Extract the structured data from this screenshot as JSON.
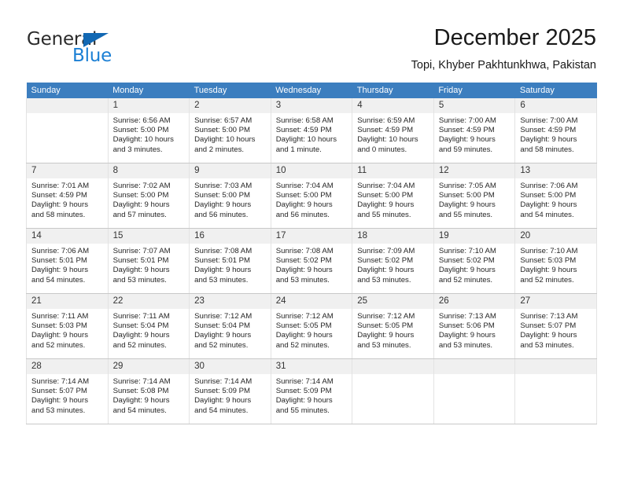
{
  "brand": {
    "name_part1": "General",
    "name_part2": "Blue",
    "accent_color": "#1b7fd4",
    "triangle_color": "#1268b3"
  },
  "header": {
    "title": "December 2025",
    "subtitle": "Topi, Khyber Pakhtunkhwa, Pakistan"
  },
  "calendar": {
    "header_bg": "#3c7ebf",
    "weekday_headers": [
      "Sunday",
      "Monday",
      "Tuesday",
      "Wednesday",
      "Thursday",
      "Friday",
      "Saturday"
    ],
    "weeks": [
      [
        {
          "day": "",
          "sunrise": "",
          "sunset": "",
          "daylight1": "",
          "daylight2": ""
        },
        {
          "day": "1",
          "sunrise": "Sunrise: 6:56 AM",
          "sunset": "Sunset: 5:00 PM",
          "daylight1": "Daylight: 10 hours",
          "daylight2": "and 3 minutes."
        },
        {
          "day": "2",
          "sunrise": "Sunrise: 6:57 AM",
          "sunset": "Sunset: 5:00 PM",
          "daylight1": "Daylight: 10 hours",
          "daylight2": "and 2 minutes."
        },
        {
          "day": "3",
          "sunrise": "Sunrise: 6:58 AM",
          "sunset": "Sunset: 4:59 PM",
          "daylight1": "Daylight: 10 hours",
          "daylight2": "and 1 minute."
        },
        {
          "day": "4",
          "sunrise": "Sunrise: 6:59 AM",
          "sunset": "Sunset: 4:59 PM",
          "daylight1": "Daylight: 10 hours",
          "daylight2": "and 0 minutes."
        },
        {
          "day": "5",
          "sunrise": "Sunrise: 7:00 AM",
          "sunset": "Sunset: 4:59 PM",
          "daylight1": "Daylight: 9 hours",
          "daylight2": "and 59 minutes."
        },
        {
          "day": "6",
          "sunrise": "Sunrise: 7:00 AM",
          "sunset": "Sunset: 4:59 PM",
          "daylight1": "Daylight: 9 hours",
          "daylight2": "and 58 minutes."
        }
      ],
      [
        {
          "day": "7",
          "sunrise": "Sunrise: 7:01 AM",
          "sunset": "Sunset: 4:59 PM",
          "daylight1": "Daylight: 9 hours",
          "daylight2": "and 58 minutes."
        },
        {
          "day": "8",
          "sunrise": "Sunrise: 7:02 AM",
          "sunset": "Sunset: 5:00 PM",
          "daylight1": "Daylight: 9 hours",
          "daylight2": "and 57 minutes."
        },
        {
          "day": "9",
          "sunrise": "Sunrise: 7:03 AM",
          "sunset": "Sunset: 5:00 PM",
          "daylight1": "Daylight: 9 hours",
          "daylight2": "and 56 minutes."
        },
        {
          "day": "10",
          "sunrise": "Sunrise: 7:04 AM",
          "sunset": "Sunset: 5:00 PM",
          "daylight1": "Daylight: 9 hours",
          "daylight2": "and 56 minutes."
        },
        {
          "day": "11",
          "sunrise": "Sunrise: 7:04 AM",
          "sunset": "Sunset: 5:00 PM",
          "daylight1": "Daylight: 9 hours",
          "daylight2": "and 55 minutes."
        },
        {
          "day": "12",
          "sunrise": "Sunrise: 7:05 AM",
          "sunset": "Sunset: 5:00 PM",
          "daylight1": "Daylight: 9 hours",
          "daylight2": "and 55 minutes."
        },
        {
          "day": "13",
          "sunrise": "Sunrise: 7:06 AM",
          "sunset": "Sunset: 5:00 PM",
          "daylight1": "Daylight: 9 hours",
          "daylight2": "and 54 minutes."
        }
      ],
      [
        {
          "day": "14",
          "sunrise": "Sunrise: 7:06 AM",
          "sunset": "Sunset: 5:01 PM",
          "daylight1": "Daylight: 9 hours",
          "daylight2": "and 54 minutes."
        },
        {
          "day": "15",
          "sunrise": "Sunrise: 7:07 AM",
          "sunset": "Sunset: 5:01 PM",
          "daylight1": "Daylight: 9 hours",
          "daylight2": "and 53 minutes."
        },
        {
          "day": "16",
          "sunrise": "Sunrise: 7:08 AM",
          "sunset": "Sunset: 5:01 PM",
          "daylight1": "Daylight: 9 hours",
          "daylight2": "and 53 minutes."
        },
        {
          "day": "17",
          "sunrise": "Sunrise: 7:08 AM",
          "sunset": "Sunset: 5:02 PM",
          "daylight1": "Daylight: 9 hours",
          "daylight2": "and 53 minutes."
        },
        {
          "day": "18",
          "sunrise": "Sunrise: 7:09 AM",
          "sunset": "Sunset: 5:02 PM",
          "daylight1": "Daylight: 9 hours",
          "daylight2": "and 53 minutes."
        },
        {
          "day": "19",
          "sunrise": "Sunrise: 7:10 AM",
          "sunset": "Sunset: 5:02 PM",
          "daylight1": "Daylight: 9 hours",
          "daylight2": "and 52 minutes."
        },
        {
          "day": "20",
          "sunrise": "Sunrise: 7:10 AM",
          "sunset": "Sunset: 5:03 PM",
          "daylight1": "Daylight: 9 hours",
          "daylight2": "and 52 minutes."
        }
      ],
      [
        {
          "day": "21",
          "sunrise": "Sunrise: 7:11 AM",
          "sunset": "Sunset: 5:03 PM",
          "daylight1": "Daylight: 9 hours",
          "daylight2": "and 52 minutes."
        },
        {
          "day": "22",
          "sunrise": "Sunrise: 7:11 AM",
          "sunset": "Sunset: 5:04 PM",
          "daylight1": "Daylight: 9 hours",
          "daylight2": "and 52 minutes."
        },
        {
          "day": "23",
          "sunrise": "Sunrise: 7:12 AM",
          "sunset": "Sunset: 5:04 PM",
          "daylight1": "Daylight: 9 hours",
          "daylight2": "and 52 minutes."
        },
        {
          "day": "24",
          "sunrise": "Sunrise: 7:12 AM",
          "sunset": "Sunset: 5:05 PM",
          "daylight1": "Daylight: 9 hours",
          "daylight2": "and 52 minutes."
        },
        {
          "day": "25",
          "sunrise": "Sunrise: 7:12 AM",
          "sunset": "Sunset: 5:05 PM",
          "daylight1": "Daylight: 9 hours",
          "daylight2": "and 53 minutes."
        },
        {
          "day": "26",
          "sunrise": "Sunrise: 7:13 AM",
          "sunset": "Sunset: 5:06 PM",
          "daylight1": "Daylight: 9 hours",
          "daylight2": "and 53 minutes."
        },
        {
          "day": "27",
          "sunrise": "Sunrise: 7:13 AM",
          "sunset": "Sunset: 5:07 PM",
          "daylight1": "Daylight: 9 hours",
          "daylight2": "and 53 minutes."
        }
      ],
      [
        {
          "day": "28",
          "sunrise": "Sunrise: 7:14 AM",
          "sunset": "Sunset: 5:07 PM",
          "daylight1": "Daylight: 9 hours",
          "daylight2": "and 53 minutes."
        },
        {
          "day": "29",
          "sunrise": "Sunrise: 7:14 AM",
          "sunset": "Sunset: 5:08 PM",
          "daylight1": "Daylight: 9 hours",
          "daylight2": "and 54 minutes."
        },
        {
          "day": "30",
          "sunrise": "Sunrise: 7:14 AM",
          "sunset": "Sunset: 5:09 PM",
          "daylight1": "Daylight: 9 hours",
          "daylight2": "and 54 minutes."
        },
        {
          "day": "31",
          "sunrise": "Sunrise: 7:14 AM",
          "sunset": "Sunset: 5:09 PM",
          "daylight1": "Daylight: 9 hours",
          "daylight2": "and 55 minutes."
        },
        {
          "day": "",
          "sunrise": "",
          "sunset": "",
          "daylight1": "",
          "daylight2": ""
        },
        {
          "day": "",
          "sunrise": "",
          "sunset": "",
          "daylight1": "",
          "daylight2": ""
        },
        {
          "day": "",
          "sunrise": "",
          "sunset": "",
          "daylight1": "",
          "daylight2": ""
        }
      ]
    ]
  }
}
